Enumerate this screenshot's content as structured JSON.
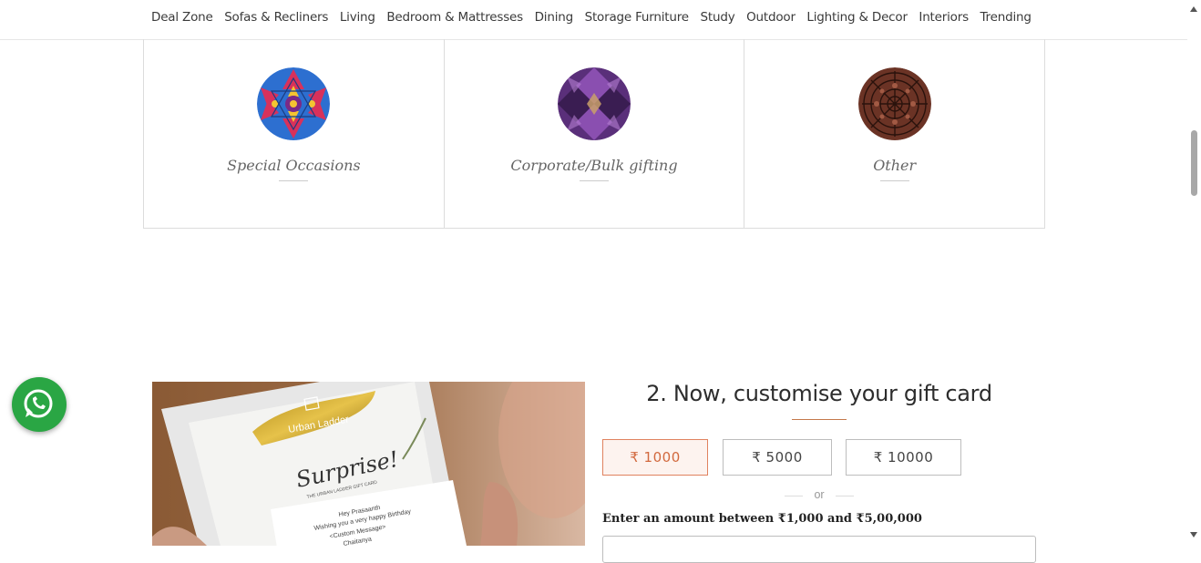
{
  "nav": {
    "items": [
      "Deal Zone",
      "Sofas & Recliners",
      "Living",
      "Bedroom & Mattresses",
      "Dining",
      "Storage Furniture",
      "Study",
      "Outdoor",
      "Lighting & Decor",
      "Interiors",
      "Trending"
    ]
  },
  "occasions": [
    {
      "label": "Special Occasions",
      "icon": "kaleidoscope-blue-pattern"
    },
    {
      "label": "Corporate/Bulk gifting",
      "icon": "kaleidoscope-purple-pattern"
    },
    {
      "label": "Other",
      "icon": "kaleidoscope-brown-pattern"
    }
  ],
  "customise": {
    "heading": "2. Now, customise your gift card",
    "amounts": [
      "₹ 1000",
      "₹ 5000",
      "₹ 10000"
    ],
    "selected_amount": "₹ 1000",
    "or_text": "or",
    "amount_hint": "Enter an amount between ₹1,000 and  ₹5,00,000",
    "amount_input_value": ""
  },
  "gift_card_image": {
    "brand": "Urban Ladder",
    "title": "Surprise!",
    "subtitle": "THE URBAN LADDER GIFT CARD",
    "greeting": "Hey Prasaanth",
    "message": "Wishing you a very happy Birthday",
    "custom_message": "<Custom Message>",
    "signature": "Chaitanya"
  },
  "colors": {
    "accent": "#d2693e",
    "whatsapp": "#2aa644",
    "selected_bg": "#fdf3ef"
  }
}
